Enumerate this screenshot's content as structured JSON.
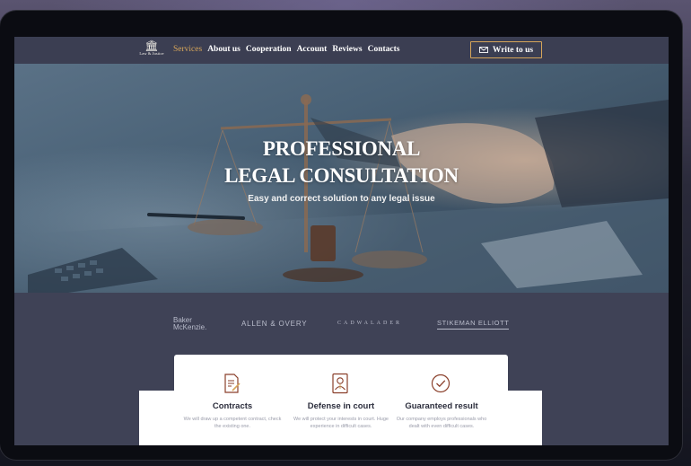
{
  "nav": {
    "logo_text": "Law & Justice",
    "items": [
      "Services",
      "About us",
      "Cooperation",
      "Account",
      "Reviews",
      "Contacts"
    ],
    "active": "Services",
    "cta_label": "Write to us"
  },
  "hero": {
    "title_line1": "PROFESSIONAL",
    "title_line2": "LEGAL CONSULTATION",
    "subtitle": "Easy and correct solution to any legal issue"
  },
  "partners": {
    "baker_line1": "Baker",
    "baker_line2": "McKenzie.",
    "allen": "ALLEN & OVERY",
    "cadwalader": "CADWALADER",
    "stikeman": "STIKEMAN ELLIOTT"
  },
  "features": [
    {
      "icon": "contract-icon",
      "title": "Contracts",
      "description": "We will draw up a competent contract, check the existing one."
    },
    {
      "icon": "lawyer-badge-icon",
      "title": "Defense in court",
      "description": "We will protect your interests in court. Huge experience in difficult cases."
    },
    {
      "icon": "check-circle-icon",
      "title": "Guaranteed result",
      "description": "Our company employs professionals who dealt with even difficult cases."
    }
  ],
  "colors": {
    "accent": "#d6a55a",
    "nav_bg": "#3b3e52",
    "icon_brown": "#8a3f2a"
  }
}
